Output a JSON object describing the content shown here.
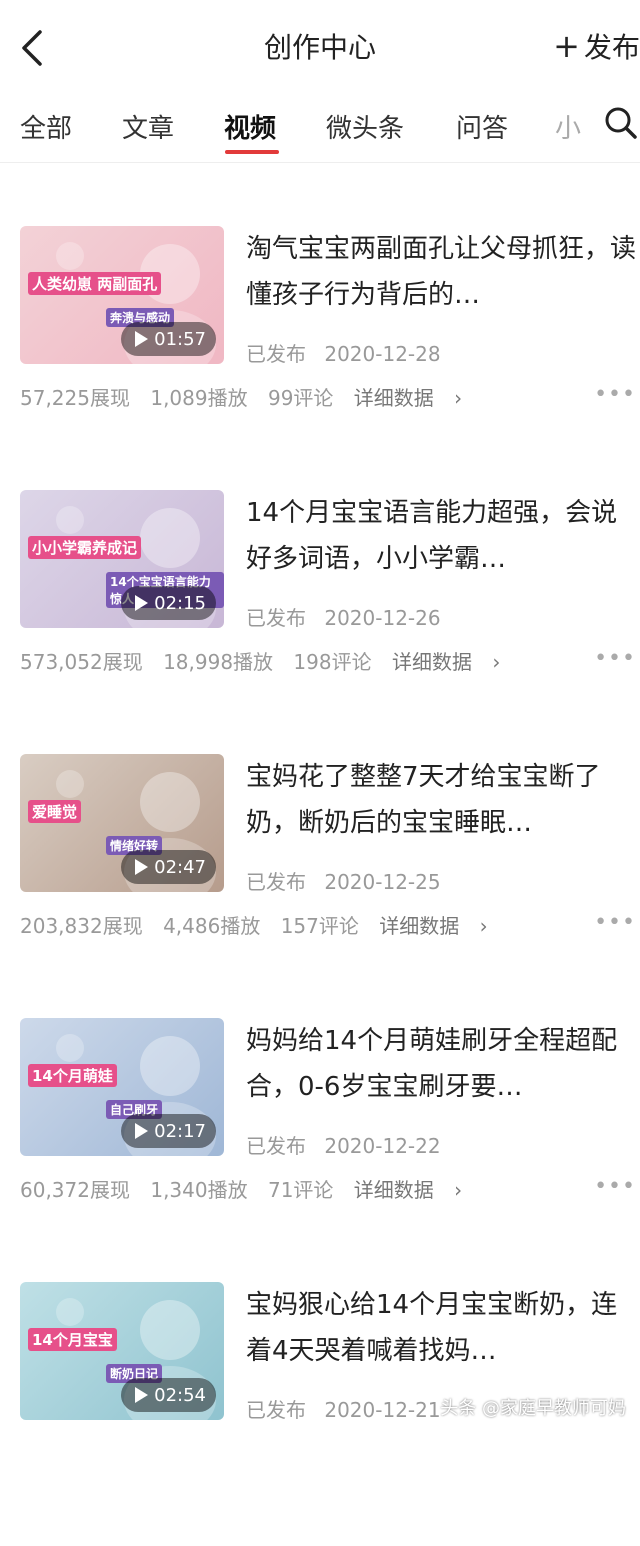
{
  "header": {
    "title": "创作中心",
    "publish_label": "发布"
  },
  "tabs": [
    {
      "label": "全部"
    },
    {
      "label": "文章"
    },
    {
      "label": "视频"
    },
    {
      "label": "微头条"
    },
    {
      "label": "问答"
    },
    {
      "label": "小"
    }
  ],
  "items": [
    {
      "title": "淘气宝宝两副面孔让父母抓狂，读懂孩子行为背后的…",
      "status": "已发布",
      "date": "2020-12-28",
      "duration": "01:57",
      "views": "57,225展现",
      "plays": "1,089播放",
      "comments": "99评论",
      "detail": "详细数据",
      "thumb_captions": [
        "人类幼崽 两副面孔",
        "奔溃与感动"
      ],
      "thumb_colors": [
        "#f3d2d7",
        "#f0b7c3"
      ]
    },
    {
      "title": "14个月宝宝语言能力超强，会说好多词语，小小学霸…",
      "status": "已发布",
      "date": "2020-12-26",
      "duration": "02:15",
      "views": "573,052展现",
      "plays": "18,998播放",
      "comments": "198评论",
      "detail": "详细数据",
      "thumb_captions": [
        "小小学霸养成记",
        "14个宝宝语言能力惊人"
      ],
      "thumb_colors": [
        "#ddd6e8",
        "#c8b7d6"
      ]
    },
    {
      "title": "宝妈花了整整7天才给宝宝断了奶，断奶后的宝宝睡眠…",
      "status": "已发布",
      "date": "2020-12-25",
      "duration": "02:47",
      "views": "203,832展现",
      "plays": "4,486播放",
      "comments": "157评论",
      "detail": "详细数据",
      "thumb_captions": [
        "爱睡觉",
        "情绪好转"
      ],
      "thumb_colors": [
        "#d9cdc3",
        "#b69c8c"
      ]
    },
    {
      "title": "妈妈给14个月萌娃刷牙全程超配合，0-6岁宝宝刷牙要…",
      "status": "已发布",
      "date": "2020-12-22",
      "duration": "02:17",
      "views": "60,372展现",
      "plays": "1,340播放",
      "comments": "71评论",
      "detail": "详细数据",
      "thumb_captions": [
        "14个月萌娃",
        "自己刷牙"
      ],
      "thumb_colors": [
        "#cdd9ea",
        "#9fb7d6"
      ]
    },
    {
      "title": "宝妈狠心给14个月宝宝断奶，连着4天哭着喊着找妈…",
      "status": "已发布",
      "date": "2020-12-21",
      "duration": "02:54",
      "views": "",
      "plays": "",
      "comments": "",
      "detail": "",
      "thumb_captions": [
        "14个月宝宝",
        "断奶日记"
      ],
      "thumb_colors": [
        "#bfe0e6",
        "#8fc3cf"
      ]
    }
  ],
  "watermark": "头条 @家庭早教师可妈"
}
